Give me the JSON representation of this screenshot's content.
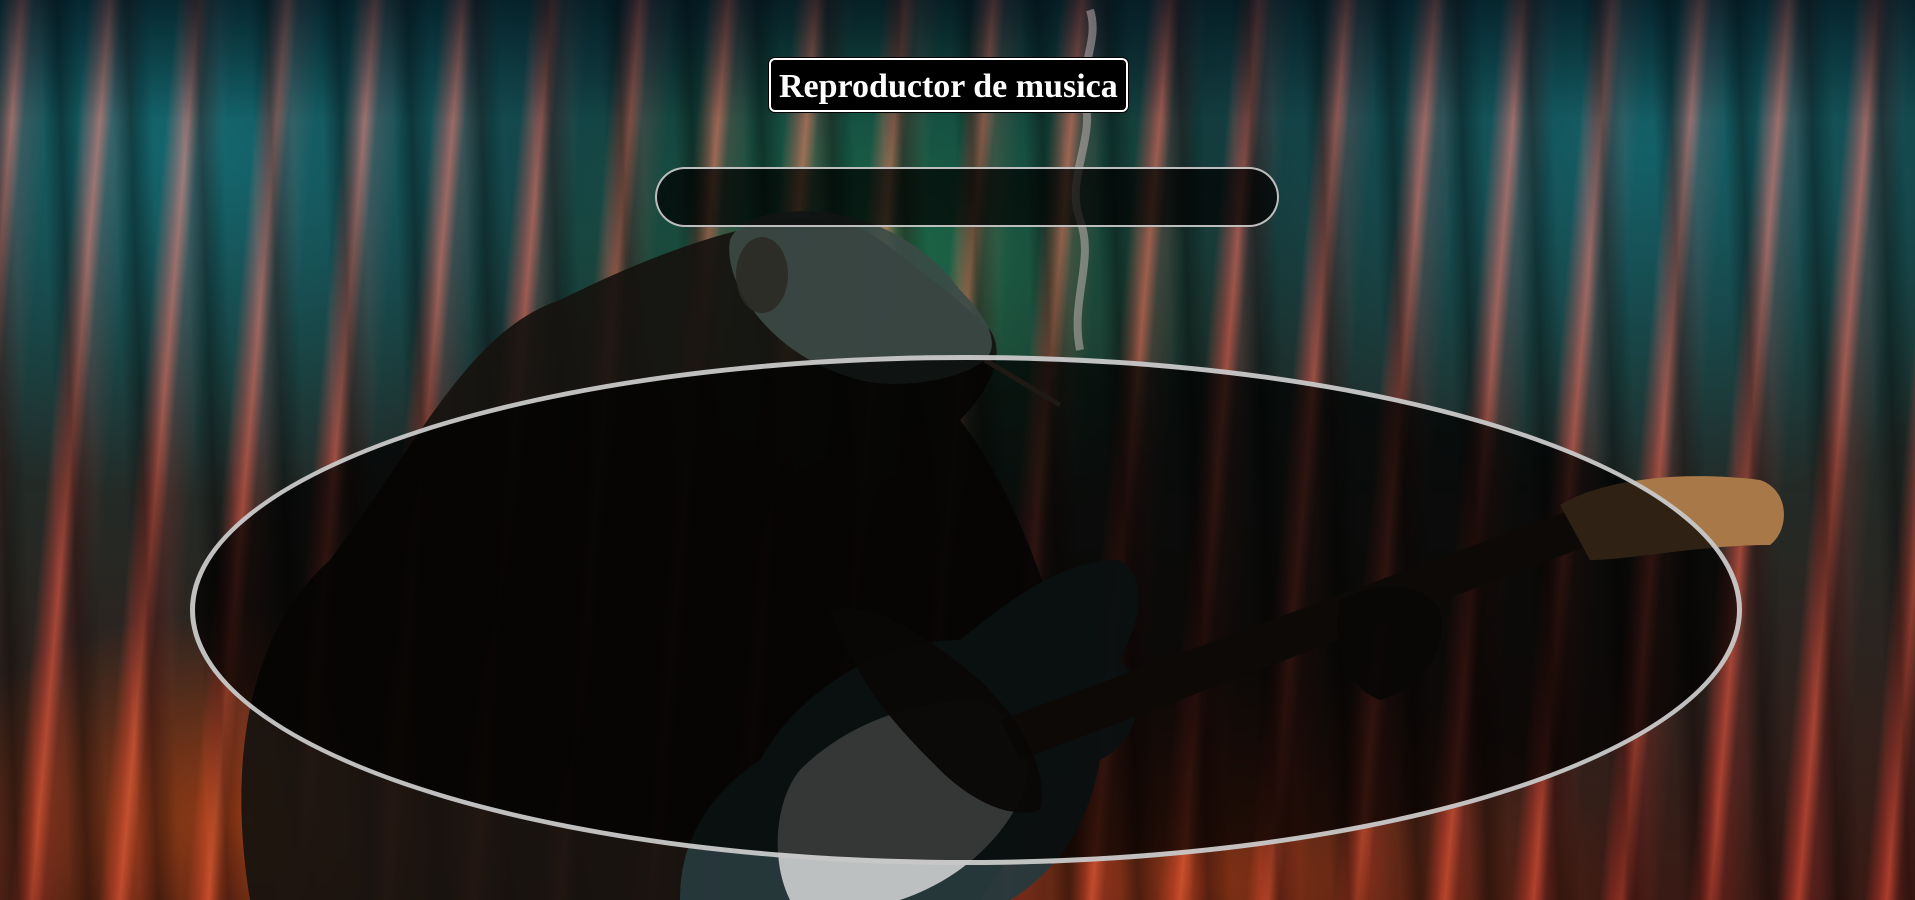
{
  "page": {
    "title": "Reproductor de musica"
  },
  "background": {
    "image": "chimpanzee-playing-electric-guitar-on-stage",
    "colors": {
      "curtain_red": "#e03c28",
      "teal_haze": "#1e8a8c",
      "green_glow": "#1e9660"
    }
  },
  "colors": {
    "title_bg": "#000000",
    "title_text": "#ffffff",
    "panel_border": "#e1e1e1"
  }
}
